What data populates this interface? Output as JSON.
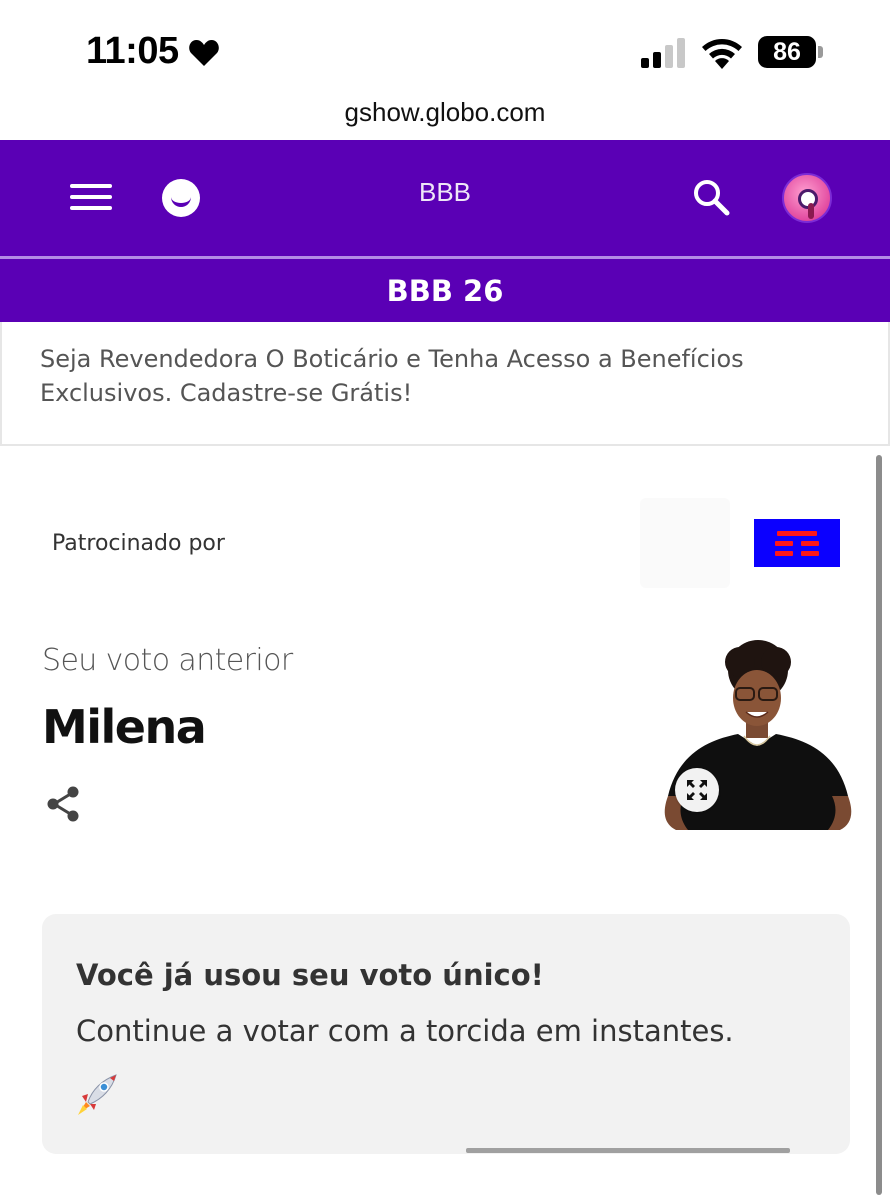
{
  "status_bar": {
    "time": "11:05",
    "battery_percent": "86",
    "icons": [
      "heart-icon",
      "signal-icon",
      "wifi-icon",
      "battery-icon"
    ]
  },
  "browser": {
    "url": "gshow.globo.com"
  },
  "header": {
    "title": "BBB",
    "subtitle": "BBB 26",
    "brand_color": "#5a00b5",
    "icons": [
      "menu-icon",
      "globo-logo-icon",
      "search-icon",
      "avatar"
    ]
  },
  "ad": {
    "text": "Seja Revendedora O Boticário e Tenha Acesso a Benefícios Exclusivos. Cadastre-se Grátis!"
  },
  "sponsor": {
    "label": "Patrocinado por",
    "logo_colors": {
      "background": "#0b00ff",
      "bars": "#ff1717"
    }
  },
  "previous_vote": {
    "label": "Seu voto anterior",
    "name": "Milena"
  },
  "info_card": {
    "title": "Você já usou seu voto único!",
    "text": "Continue a votar com a torcida em instantes.",
    "emoji": "rocket-icon"
  }
}
